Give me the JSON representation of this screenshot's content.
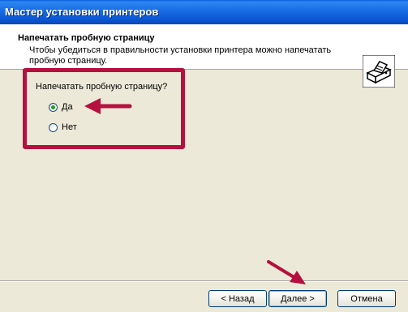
{
  "window": {
    "title": "Мастер установки принтеров"
  },
  "header": {
    "title": "Напечатать пробную страницу",
    "subtitle": "Чтобы убедиться в правильности установки принтера можно напечатать пробную страницу."
  },
  "question": {
    "label": "Напечатать пробную страницу?",
    "options": [
      {
        "label": "Да",
        "checked": true
      },
      {
        "label": "Нет",
        "checked": false
      }
    ]
  },
  "buttons": {
    "back": "< Назад",
    "next": "Далее >",
    "cancel": "Отмена"
  },
  "annotations": {
    "color": "#B5103F"
  },
  "icons": {
    "header": "printer-icon"
  }
}
